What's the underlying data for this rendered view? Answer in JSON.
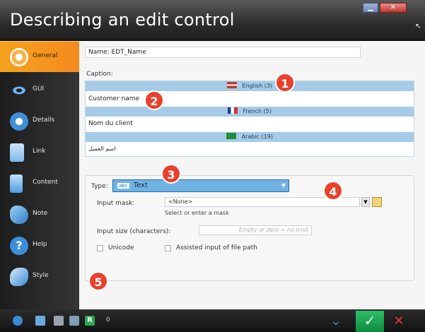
{
  "window": {
    "title": "Describing an edit control",
    "min_glyph": "▁",
    "close_glyph": "✕",
    "cursor_glyph": "↖"
  },
  "sidebar": {
    "items": [
      {
        "label": "General",
        "icon": "target-icon",
        "active": true
      },
      {
        "label": "GUI",
        "icon": "eye-icon"
      },
      {
        "label": "Details",
        "icon": "heart-icon"
      },
      {
        "label": "Link",
        "icon": "link-icon"
      },
      {
        "label": "Content",
        "icon": "content-icon"
      },
      {
        "label": "Note",
        "icon": "note-icon"
      },
      {
        "label": "Help",
        "icon": "help-icon"
      },
      {
        "label": "Style",
        "icon": "style-icon"
      }
    ]
  },
  "form": {
    "name_label": "Name:",
    "name_value": "EDT_Name",
    "caption_label": "Caption:",
    "languages": [
      {
        "header": "English (3)",
        "value": "Customer name",
        "flag": "uk"
      },
      {
        "header": "French (5)",
        "value": "Nom du client",
        "flag": "fr"
      },
      {
        "header": "Arabic (19)",
        "value": "اسم العميل",
        "flag": "sa"
      }
    ],
    "type_label": "Type:",
    "type_value": "Text",
    "type_icon_text": "abc",
    "input_mask_label": "Input mask:",
    "input_mask_value": "<None>",
    "input_mask_hint": "Select or enter a mask",
    "input_size_label": "Input size (characters):",
    "input_size_placeholder": "Empty or zero = no limit",
    "unicode_label": "Unicode",
    "assisted_label": "Assisted input of file path"
  },
  "badges": [
    "1",
    "2",
    "3",
    "4",
    "5"
  ],
  "bottom": {
    "count": "0",
    "ok_glyph": "✓",
    "cancel_glyph": "✕",
    "chevron_glyph": "⌄"
  },
  "colors": {
    "accent": "#f58a1f",
    "badge": "#e9412b",
    "ok": "#1aa44f",
    "cancel": "#e43c3c"
  }
}
